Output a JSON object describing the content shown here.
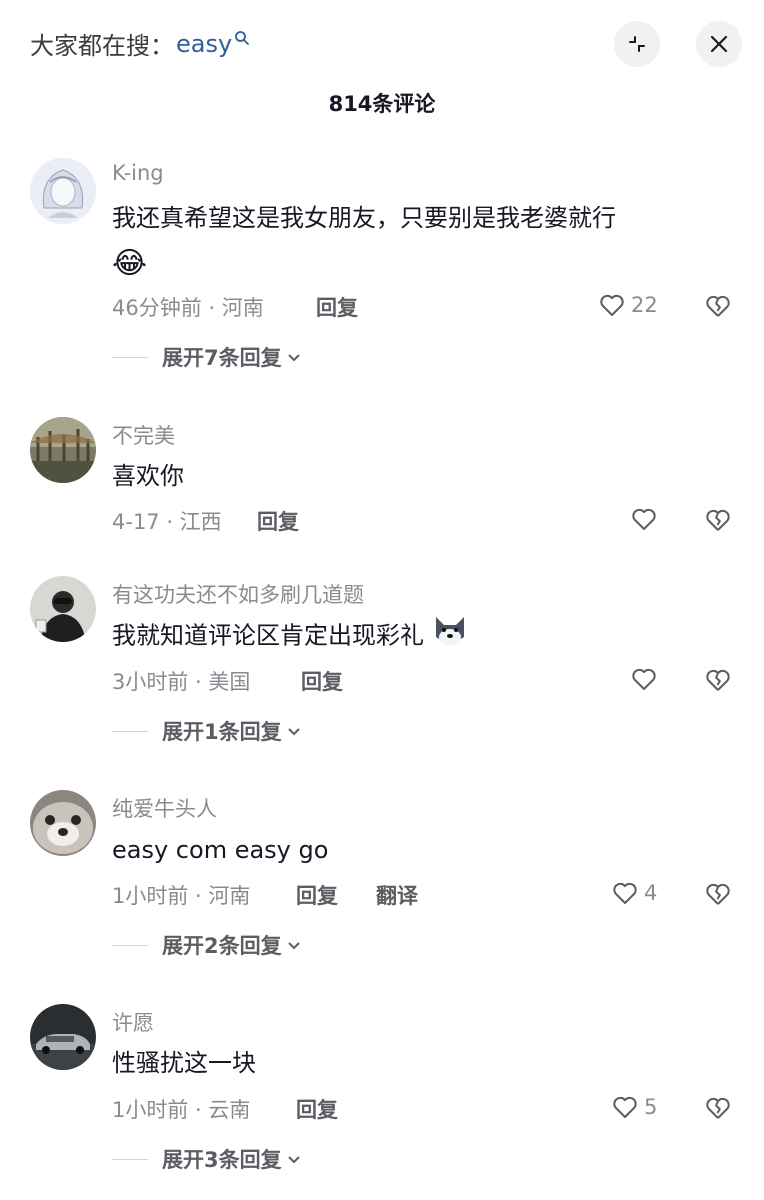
{
  "header": {
    "search_prefix": "大家都在搜：",
    "search_keyword": "easy",
    "comment_count": "814条评论"
  },
  "comments": [
    {
      "username": "K-ing",
      "text_line1": "我还真希望这是我女朋友，只要别是我老婆就行",
      "emoji": "😂",
      "time_location": "46分钟前 · 河南",
      "reply_label": "回复",
      "likes": "22",
      "expand_label": "展开7条回复"
    },
    {
      "username": "不完美",
      "text_line1": "喜欢你",
      "time_location": "4-17 · 江西",
      "reply_label": "回复"
    },
    {
      "username": "有这功夫还不如多刷几道题",
      "text_line1": "我就知道评论区肯定出现彩礼",
      "emoji": "husky-emoji",
      "time_location": "3小时前 · 美国",
      "reply_label": "回复",
      "expand_label": "展开1条回复"
    },
    {
      "username": "纯爱牛头人",
      "text_line1": "easy com  easy go",
      "time_location": "1小时前 · 河南",
      "reply_label": "回复",
      "translate_label": "翻译",
      "likes": "4",
      "expand_label": "展开2条回复"
    },
    {
      "username": "许愿",
      "text_line1": "性骚扰这一块",
      "time_location": "1小时前 · 云南",
      "reply_label": "回复",
      "likes": "5",
      "expand_label": "展开3条回复"
    }
  ],
  "icons": {
    "search": "search-icon",
    "collapse": "collapse-icon",
    "close": "close-icon",
    "like": "heart-icon",
    "dislike": "broken-heart-icon",
    "chevron": "chevron-down-icon"
  },
  "colors": {
    "keyword": "#2f5f9e",
    "muted": "#8a8b91",
    "text": "#161823",
    "action": "#5c5d63"
  }
}
